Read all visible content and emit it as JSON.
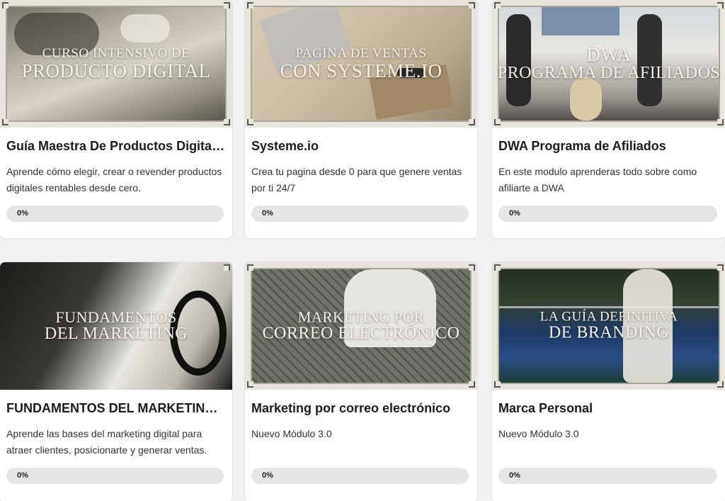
{
  "courses": [
    {
      "thumb_line1": "CURSO INTENSIVO DE",
      "thumb_line2": "PRODUCTO DIGITAL",
      "title": "Guía Maestra De Productos Digitales",
      "description": "Aprende cómo elegir, crear o revender productos digitales rentables desde cero.",
      "progress_label": "0%",
      "progress": 0
    },
    {
      "thumb_line1": "PAGINA DE VENTAS",
      "thumb_line2": "CON SYSTEME.IO",
      "title": "Systeme.io",
      "description": "Crea tu pagina desde 0 para que genere ventas por ti 24/7",
      "progress_label": "0%",
      "progress": 0
    },
    {
      "thumb_line1": "DWA",
      "thumb_line2": "PROGRAMA DE AFILIADOS",
      "title": "DWA Programa de Afiliados",
      "description": "En este modulo aprenderas todo sobre como afiliarte a DWA",
      "progress_label": "0%",
      "progress": 0
    },
    {
      "thumb_line1": "FUNDAMENTOS",
      "thumb_line2": "DEL MARKETING",
      "title": "FUNDAMENTOS DEL MARKETING DIGITAL",
      "description": "Aprende las bases del marketing digital para atraer clientes, posicionarte y generar ventas.",
      "progress_label": "0%",
      "progress": 0
    },
    {
      "thumb_line1": "MARKETING POR",
      "thumb_line2": "CORREO ELECTRÓNICO",
      "title": "Marketing por correo electrónico",
      "description": "Nuevo Módulo 3.0",
      "progress_label": "0%",
      "progress": 0
    },
    {
      "thumb_line1": "LA GUÍA DEFINITIVA",
      "thumb_line2": "DE BRANDING",
      "title": "Marca Personal",
      "description": "Nuevo Módulo 3.0",
      "progress_label": "0%",
      "progress": 0
    }
  ]
}
